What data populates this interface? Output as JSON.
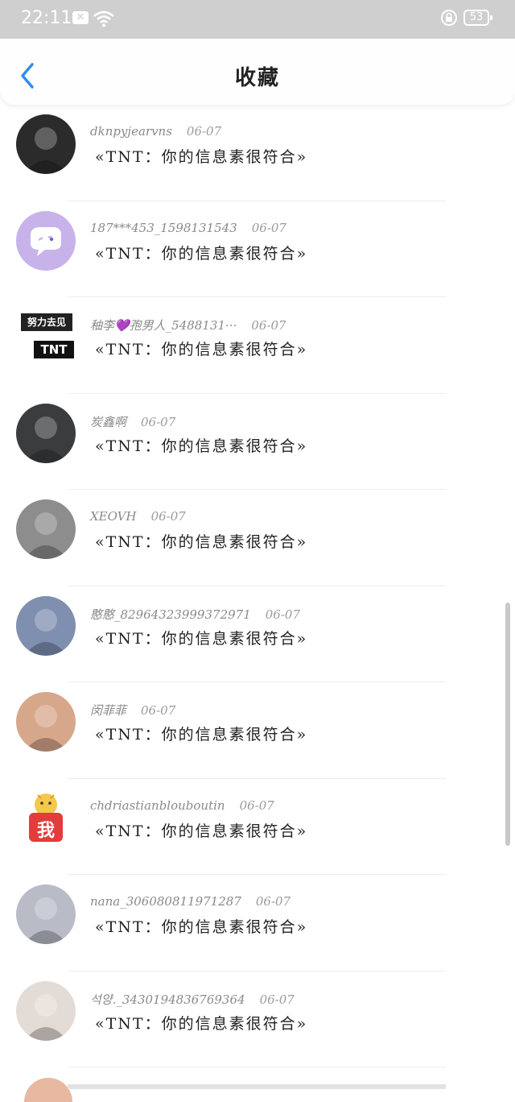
{
  "status_bar": {
    "time": "22:11",
    "battery": "53"
  },
  "header": {
    "title": "收藏"
  },
  "items": [
    {
      "name": "dknpyjearvns",
      "date": "06-07",
      "content": "«TNT：你的信息素很符合»",
      "avatar_color": "#2b2b2b",
      "avatar_label": ""
    },
    {
      "name": "187***453_1598131543",
      "date": "06-07",
      "content": "«TNT：你的信息素很符合»",
      "avatar_color": "#c7b3ea",
      "avatar_label": ""
    },
    {
      "name": "秞李💜孢男人_5488131···",
      "date": "06-07",
      "content": "«TNT：你的信息素很符合»",
      "avatar_color": "#ffffff",
      "avatar_label": "努力去见"
    },
    {
      "name": "炭鑫啊",
      "date": "06-07",
      "content": "«TNT：你的信息素很符合»",
      "avatar_color": "#3a3c3e",
      "avatar_label": ""
    },
    {
      "name": "XEOVH",
      "date": "06-07",
      "content": "«TNT：你的信息素很符合»",
      "avatar_color": "#8d8d8d",
      "avatar_label": ""
    },
    {
      "name": "憨憨_82964323999372971",
      "date": "06-07",
      "content": "«TNT：你的信息素很符合»",
      "avatar_color": "#7f8fb0",
      "avatar_label": ""
    },
    {
      "name": "闵菲菲",
      "date": "06-07",
      "content": "«TNT：你的信息素很符合»",
      "avatar_color": "#d7a78c",
      "avatar_label": ""
    },
    {
      "name": "chdriastianblouboutin",
      "date": "06-07",
      "content": "«TNT：你的信息素很符合»",
      "avatar_color": "#ffffff",
      "avatar_label": "我"
    },
    {
      "name": "nana_306080811971287",
      "date": "06-07",
      "content": "«TNT：你的信息素很符合»",
      "avatar_color": "#b9bcc7",
      "avatar_label": ""
    },
    {
      "name": "석양._3430194836769364",
      "date": "06-07",
      "content": "«TNT：你的信息素很符合»",
      "avatar_color": "#e3dcd6",
      "avatar_label": ""
    }
  ]
}
